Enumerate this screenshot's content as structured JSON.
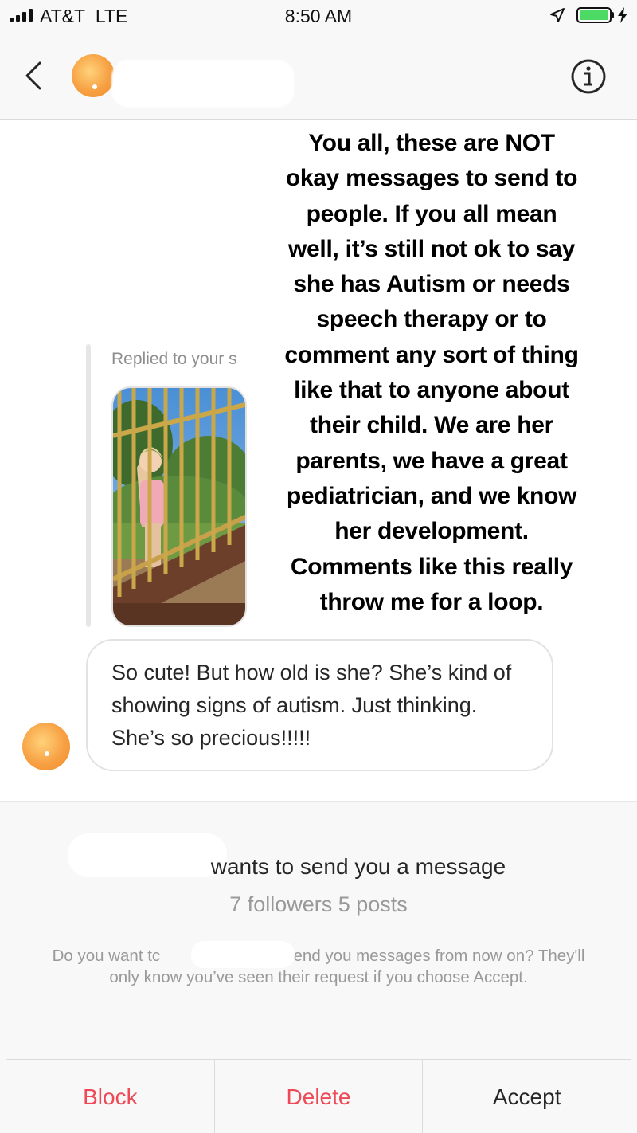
{
  "status_bar": {
    "carrier": "AT&T",
    "network": "LTE",
    "time": "8:50 AM",
    "battery_level": 1.0,
    "icons": [
      "signal-bars-icon",
      "location-arrow-icon",
      "battery-icon",
      "charging-bolt-icon"
    ]
  },
  "header": {
    "icons": [
      "back-chevron-icon",
      "info-icon"
    ]
  },
  "thread": {
    "reply_label": "Replied to your s",
    "overlay_lines": [
      "You all, these are NOT",
      "okay messages to send to",
      "people. If you all mean",
      "well, it’s still not ok to say",
      "she has Autism or needs",
      "speech therapy or to",
      "comment any sort of thing",
      "like that to anyone about",
      "their child. We are her",
      "parents, we have a great",
      "pediatrician, and we know",
      "her development.",
      "Comments like this really",
      "throw me for a loop."
    ],
    "message": "So cute! But how old is she? She’s kind of showing signs of autism. Just thinking. She’s so precious!!!!!"
  },
  "request": {
    "title_visible": "wants to send you a message",
    "stats": "7 followers 5 posts",
    "body_start": "Do you want tc",
    "body_end": "u send you messages from now on? They'll only know you’ve seen their request if you choose Accept.",
    "actions": {
      "block": "Block",
      "delete": "Delete",
      "accept": "Accept"
    }
  },
  "colors": {
    "destructive": "#ed4956",
    "primary_text": "#262626",
    "secondary_text": "#999999",
    "divider": "#dbdbdb",
    "bar_background": "#f8f8f8",
    "battery_green": "#4cd964"
  }
}
